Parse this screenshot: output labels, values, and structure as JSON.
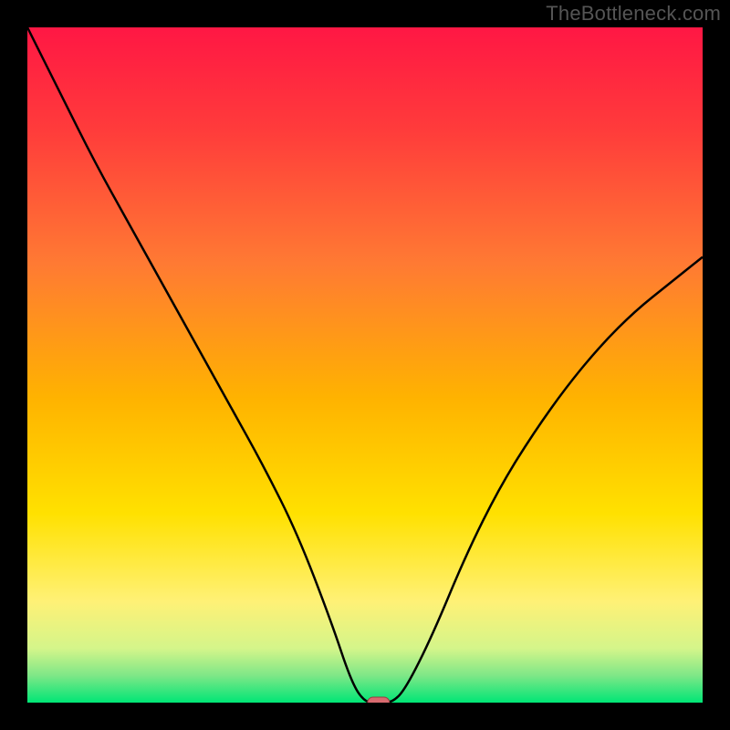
{
  "watermark": "TheBottleneck.com",
  "chart_data": {
    "type": "line",
    "title": "",
    "xlabel": "",
    "ylabel": "",
    "xlim": [
      0,
      100
    ],
    "ylim": [
      0,
      100
    ],
    "x": [
      0,
      5,
      10,
      15,
      20,
      25,
      30,
      35,
      40,
      45,
      48,
      50,
      52,
      54,
      56,
      60,
      65,
      70,
      75,
      80,
      85,
      90,
      95,
      100
    ],
    "values": [
      100,
      90,
      80,
      71,
      62,
      53,
      44,
      35,
      25,
      12,
      3,
      0,
      0,
      0,
      2,
      10,
      22,
      32,
      40,
      47,
      53,
      58,
      62,
      66
    ],
    "marker": {
      "x": 52,
      "y": 0
    },
    "gradient_stops": [
      {
        "offset": 0.0,
        "color": "#ff1744"
      },
      {
        "offset": 0.15,
        "color": "#ff3b3b"
      },
      {
        "offset": 0.35,
        "color": "#ff7a33"
      },
      {
        "offset": 0.55,
        "color": "#ffb300"
      },
      {
        "offset": 0.72,
        "color": "#ffe100"
      },
      {
        "offset": 0.85,
        "color": "#fff176"
      },
      {
        "offset": 0.92,
        "color": "#d4f58a"
      },
      {
        "offset": 0.96,
        "color": "#7ee787"
      },
      {
        "offset": 1.0,
        "color": "#00e676"
      }
    ],
    "colors": {
      "curve": "#000000",
      "marker_fill": "#d86a6f",
      "marker_stroke": "#9c3b40",
      "background": "#000000"
    }
  }
}
